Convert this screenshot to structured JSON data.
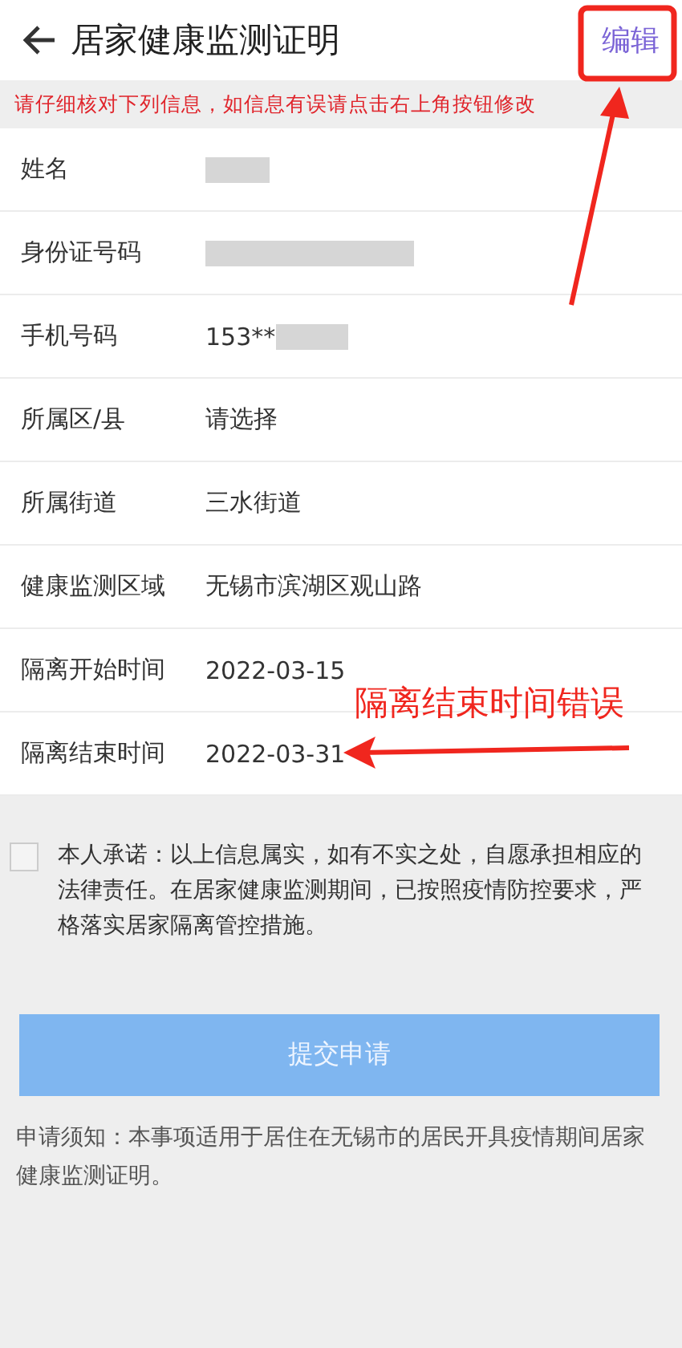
{
  "header": {
    "title": "居家健康监测证明",
    "edit_button": "编辑"
  },
  "notice": "请仔细核对下列信息，如信息有误请点击右上角按钮修改",
  "fields": [
    {
      "label": "姓名",
      "redacted": true
    },
    {
      "label": "身份证号码",
      "redacted": true
    },
    {
      "label": "手机号码",
      "value": "153**",
      "redacted": true
    },
    {
      "label": "所属区/县",
      "value": "请选择",
      "redacted": false
    },
    {
      "label": "所属街道",
      "value": "三水街道",
      "redacted": false
    },
    {
      "label": "健康监测区域",
      "value": "无锡市滨湖区观山路",
      "redacted": false
    },
    {
      "label": "隔离开始时间",
      "value": "2022-03-15",
      "redacted": false
    },
    {
      "label": "隔离结束时间",
      "value": "2022-03-31",
      "redacted": false
    }
  ],
  "pledge": {
    "checked": false,
    "text": "本人承诺：以上信息属实，如有不实之处，自愿承担相应的法律责任。在居家健康监测期间，已按照疫情防控要求，严格落实居家隔离管控措施。"
  },
  "submit_button": "提交申请",
  "footnote": "申请须知：本事项适用于居住在无锡市的居民开具疫情期间居家健康监测证明。",
  "annotation": {
    "text": "隔离结束时间错误"
  }
}
